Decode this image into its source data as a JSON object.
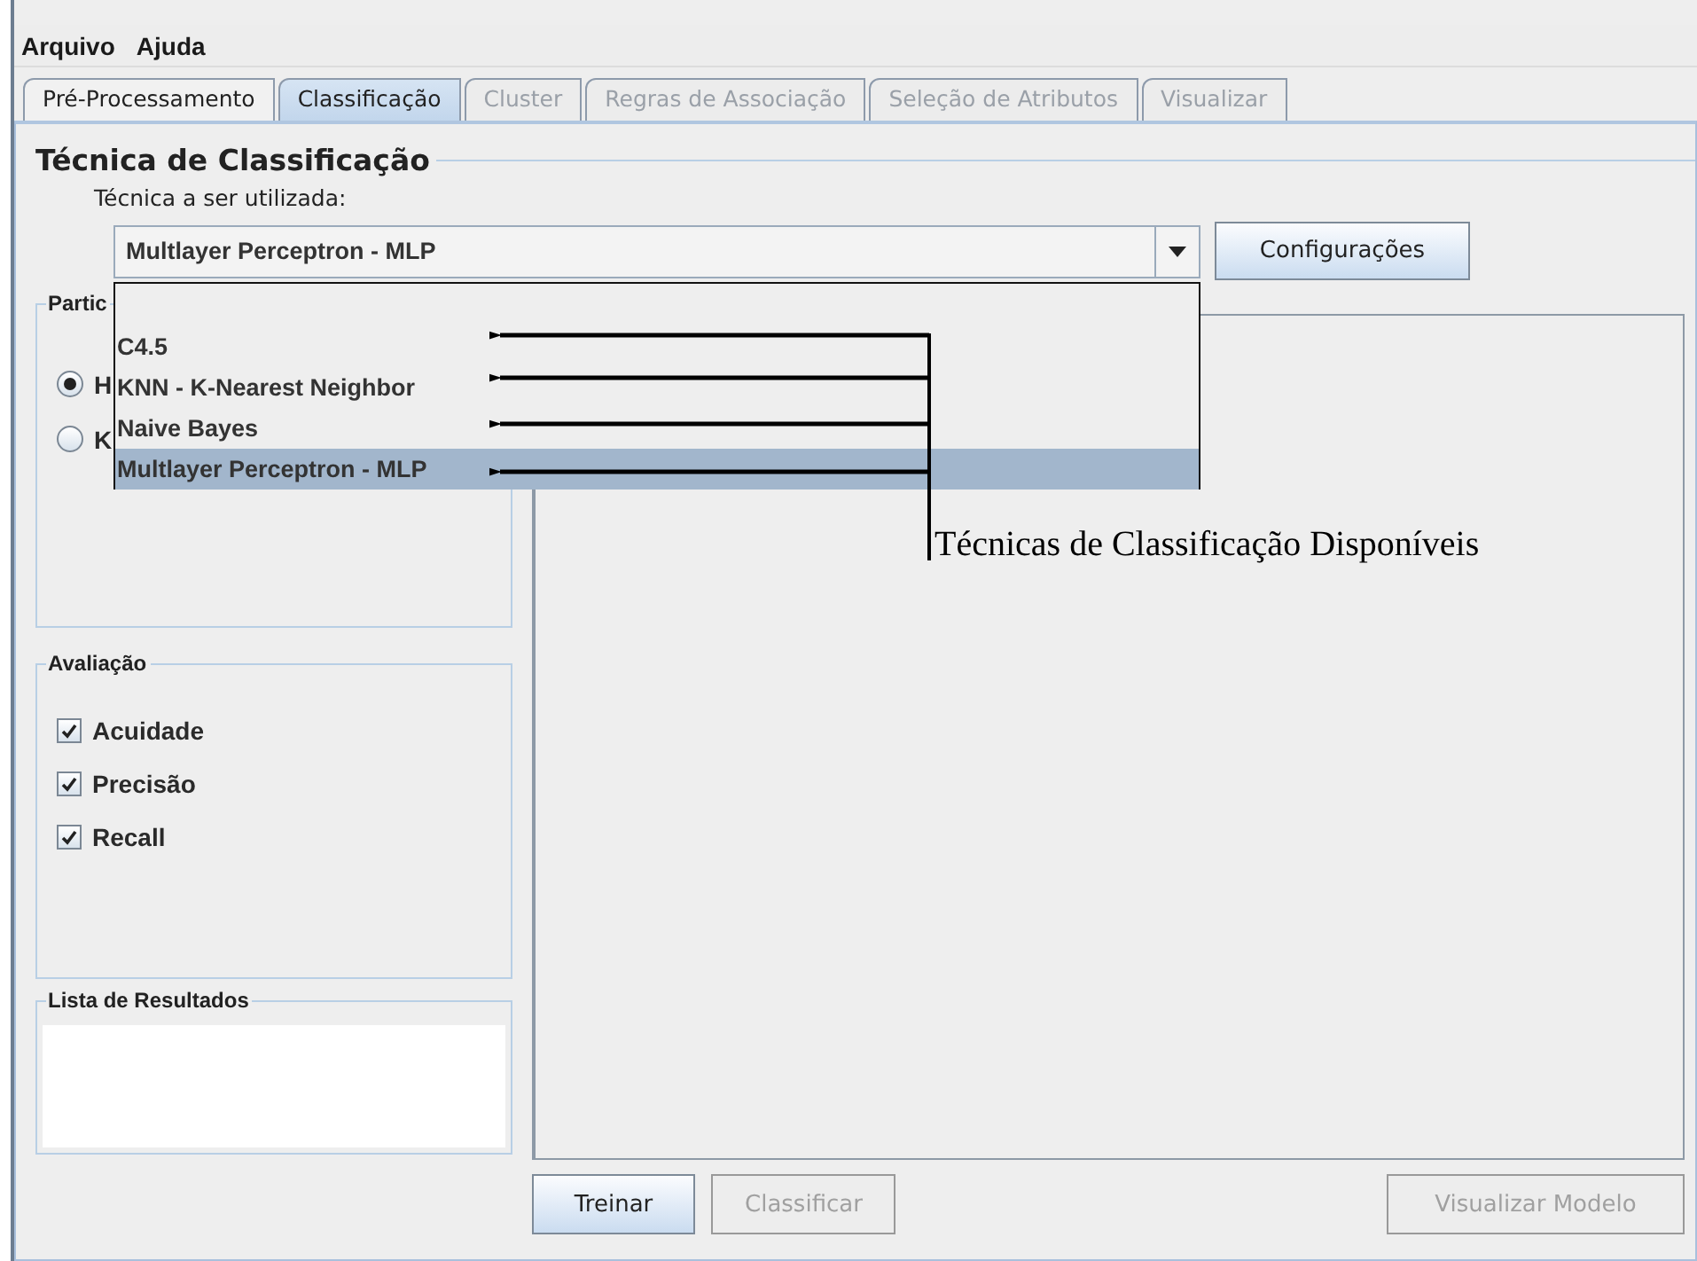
{
  "menu": [
    "Arquivo",
    "Ajuda"
  ],
  "tabs": [
    {
      "label": "Pré-Processamento",
      "selected": false,
      "disabled": false
    },
    {
      "label": "Classificação",
      "selected": true,
      "disabled": false
    },
    {
      "label": "Cluster",
      "selected": false,
      "disabled": true
    },
    {
      "label": "Regras de Associação",
      "selected": false,
      "disabled": true
    },
    {
      "label": "Seleção de Atributos",
      "selected": false,
      "disabled": true
    },
    {
      "label": "Visualizar",
      "selected": false,
      "disabled": true
    }
  ],
  "technique": {
    "title": "Técnica de Classificação",
    "label": "Técnica a ser utilizada:",
    "value": "Multlayer Perceptron - MLP",
    "settings_button": "Configurações",
    "options": [
      {
        "label": "C4.5",
        "selected": false
      },
      {
        "label": "KNN - K-Nearest Neighbor",
        "selected": false
      },
      {
        "label": "Naive Bayes",
        "selected": false
      },
      {
        "label": "Multlayer Perceptron - MLP",
        "selected": true
      }
    ]
  },
  "partition": {
    "title": "Partic",
    "options": [
      {
        "label": "H",
        "selected": true
      },
      {
        "label": "K",
        "selected": false
      }
    ]
  },
  "evaluation": {
    "title": "Avaliação",
    "metrics": [
      {
        "label": "Acuidade",
        "checked": true
      },
      {
        "label": "Precisão",
        "checked": true
      },
      {
        "label": "Recall",
        "checked": true
      }
    ]
  },
  "results": {
    "title": "Lista de Resultados"
  },
  "buttons": [
    {
      "label": "Treinar",
      "disabled": false
    },
    {
      "label": "Classificar",
      "disabled": true
    },
    {
      "label": "Visualizar Modelo",
      "disabled": true
    }
  ],
  "annotation": {
    "label": "Técnicas de Classificação Disponíveis"
  }
}
